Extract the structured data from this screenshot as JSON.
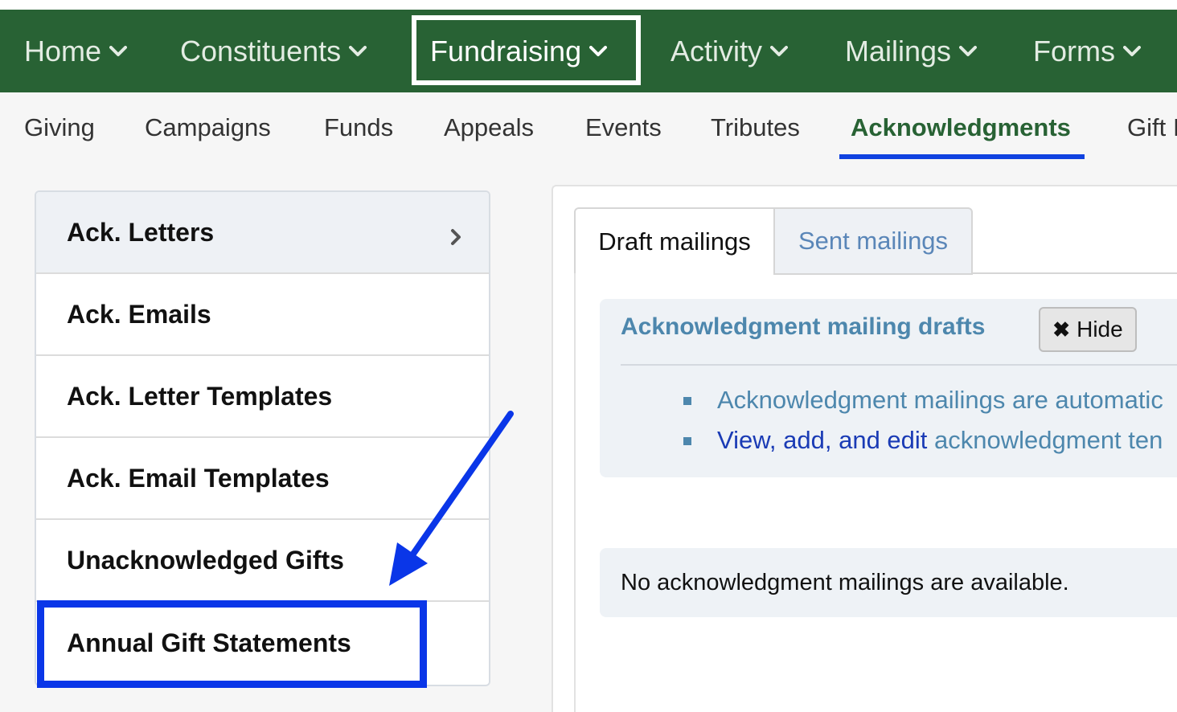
{
  "main_nav": {
    "items": [
      {
        "label": "Home"
      },
      {
        "label": "Constituents"
      },
      {
        "label": "Fundraising"
      },
      {
        "label": "Activity"
      },
      {
        "label": "Mailings"
      },
      {
        "label": "Forms"
      }
    ],
    "active": "Fundraising"
  },
  "sub_nav": {
    "items": [
      {
        "label": "Giving"
      },
      {
        "label": "Campaigns"
      },
      {
        "label": "Funds"
      },
      {
        "label": "Appeals"
      },
      {
        "label": "Events"
      },
      {
        "label": "Tributes"
      },
      {
        "label": "Acknowledgments"
      },
      {
        "label": "Gift I"
      }
    ],
    "active": "Acknowledgments"
  },
  "left_menu": {
    "items": [
      {
        "label": "Ack. Letters"
      },
      {
        "label": "Ack. Emails"
      },
      {
        "label": "Ack. Letter Templates"
      },
      {
        "label": "Ack. Email Templates"
      },
      {
        "label": "Unacknowledged Gifts"
      },
      {
        "label": "Annual Gift Statements"
      }
    ]
  },
  "tabs": {
    "draft": "Draft mailings",
    "sent": "Sent mailings"
  },
  "drafts_panel": {
    "title": "Acknowledgment mailing drafts",
    "hide_label": "Hide",
    "bullet1": "Acknowledgment mailings are automatic",
    "bullet2_link": "View, add, and edit",
    "bullet2_rest": " acknowledgment ten"
  },
  "empty_message": "No acknowledgment mailings are available.",
  "colors": {
    "nav_green": "#286234",
    "annotation_blue": "#0a36e8",
    "link_blue": "#1a3bb5",
    "muted_blue": "#4d87ad"
  },
  "icons": [
    "chevron-down-icon",
    "chevron-right-icon",
    "close-icon"
  ]
}
